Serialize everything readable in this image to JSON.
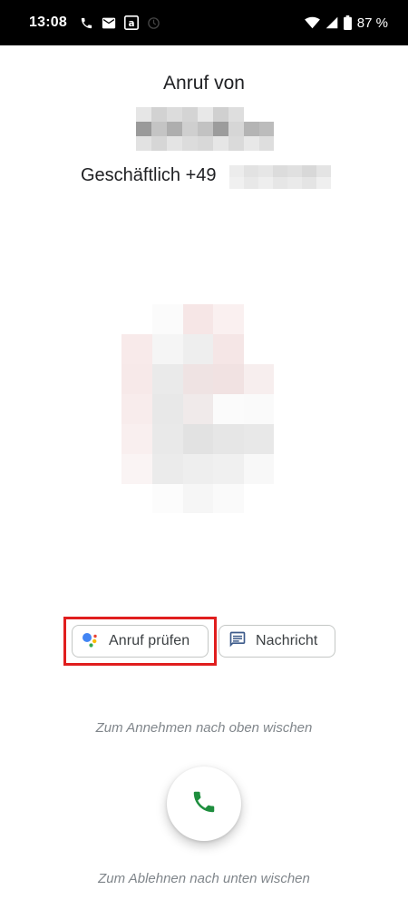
{
  "status_bar": {
    "time": "13:08",
    "battery_text": "87 %",
    "icons": [
      "phone-icon",
      "mail-icon",
      "amazon-icon",
      "sync-icon",
      "wifi-icon",
      "signal-icon",
      "battery-icon"
    ]
  },
  "caller": {
    "heading": "Anruf von",
    "name_redacted": true,
    "number_label": "Geschäftlich +49",
    "number_redacted": true,
    "avatar_redacted": true
  },
  "actions": {
    "screen_call_label": "Anruf prüfen",
    "screen_call_icon": "google-assistant-icon",
    "message_label": "Nachricht",
    "message_icon": "message-icon"
  },
  "hints": {
    "swipe_up": "Zum Annehmen nach oben wischen",
    "swipe_down": "Zum Ablehnen nach unten wischen"
  },
  "answer_button": {
    "icon": "phone-icon"
  },
  "colors": {
    "highlight": "#e01e1e",
    "answer_green": "#1e8e3e",
    "assistant_blue": "#4285f4",
    "assistant_red": "#ea4335",
    "assistant_yellow": "#fbbc04",
    "assistant_green": "#34a853",
    "message_icon": "#3c5a8a"
  }
}
